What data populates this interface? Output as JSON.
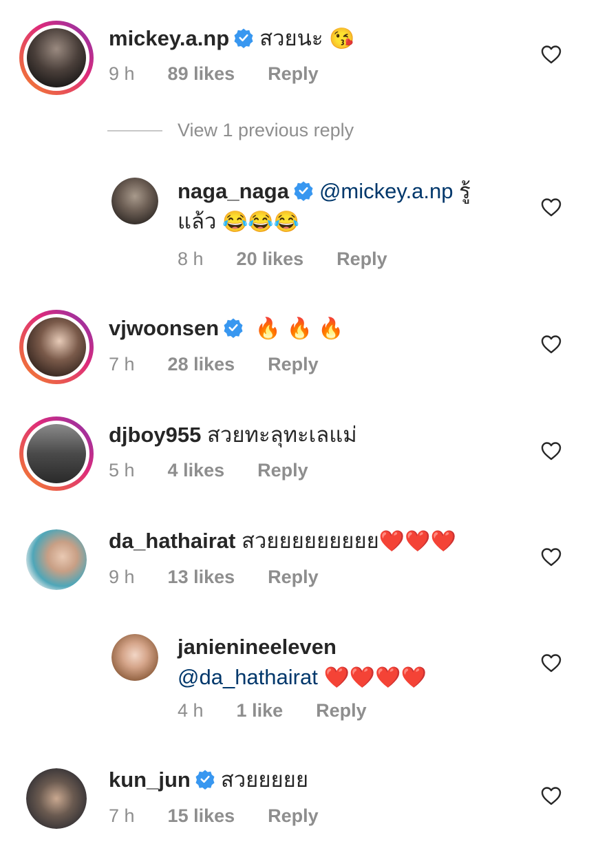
{
  "comments": [
    {
      "username": "mickey.a.np",
      "verified": true,
      "text": "สวยนะ",
      "emoji": "😘",
      "time": "9 h",
      "likes": "89 likes",
      "reply": "Reply"
    },
    {
      "username": "naga_naga",
      "verified": true,
      "mention": "@mickey.a.np",
      "text": "รู้แล้ว",
      "emoji": "😂😂😂",
      "time": "8 h",
      "likes": "20 likes",
      "reply": "Reply"
    },
    {
      "username": "vjwoonsen",
      "verified": true,
      "emoji": "🔥 🔥 🔥",
      "time": "7 h",
      "likes": "28 likes",
      "reply": "Reply"
    },
    {
      "username": "djboy955",
      "text": "สวยทะลุทะเลแม่",
      "time": "5 h",
      "likes": "4 likes",
      "reply": "Reply"
    },
    {
      "username": "da_hathairat",
      "text": "สวยยยยยยยยย",
      "emoji": "❤️❤️❤️",
      "time": "9 h",
      "likes": "13 likes",
      "reply": "Reply"
    },
    {
      "username": "janienineeleven",
      "mention": "@da_hathairat",
      "emoji": "❤️❤️❤️❤️",
      "time": "4 h",
      "likes": "1 like",
      "reply": "Reply"
    },
    {
      "username": "kun_jun",
      "verified": true,
      "text": "สวยยยยย",
      "time": "7 h",
      "likes": "15 likes",
      "reply": "Reply"
    }
  ],
  "view_previous_reply": "View 1 previous reply",
  "icons": {
    "verified": "verified-badge-icon",
    "like": "heart-outline-icon"
  },
  "colors": {
    "verified": "#3897f0",
    "mention": "#00376b",
    "meta": "#8e8e8e"
  }
}
